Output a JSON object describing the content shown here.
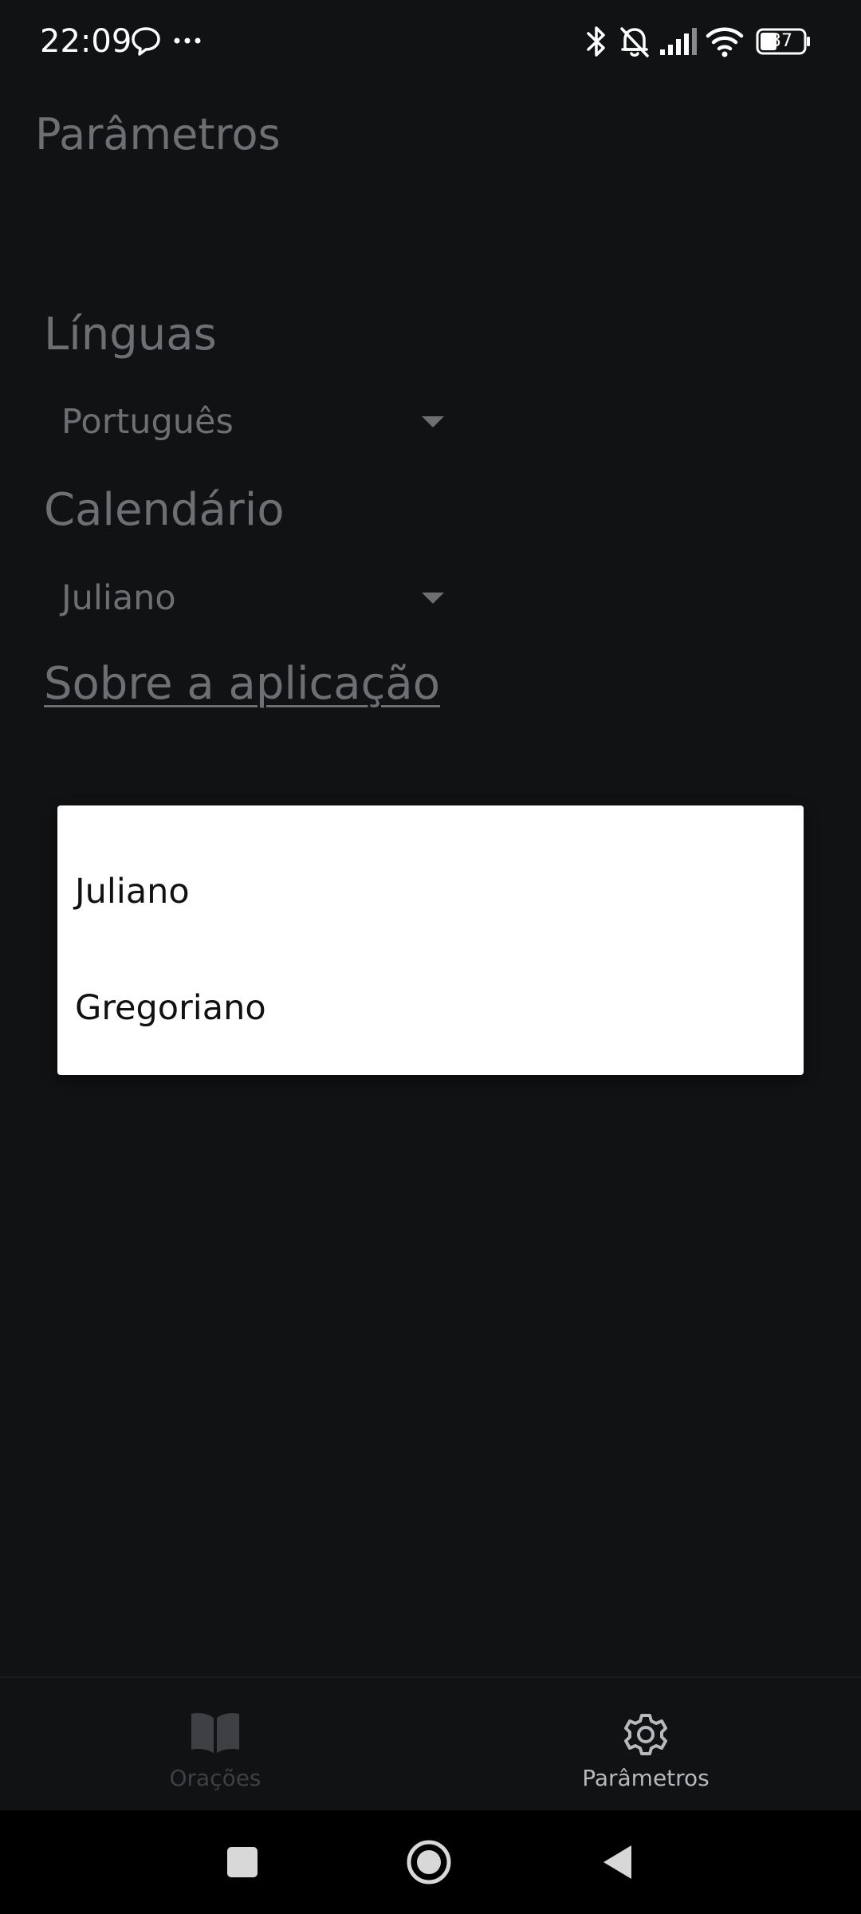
{
  "status_bar": {
    "time": "22:09",
    "battery_level": "37",
    "icons": [
      "chat-bubble-icon",
      "more-dots-icon",
      "bluetooth-icon",
      "bell-off-icon",
      "cellular-signal-icon",
      "wifi-icon",
      "battery-icon"
    ]
  },
  "app_bar": {
    "title": "Parâmetros"
  },
  "settings": {
    "languages_heading": "Línguas",
    "language_selected": "Português",
    "calendar_heading": "Calendário",
    "calendar_selected": "Juliano",
    "about_link": "Sobre a aplicação"
  },
  "dropdown": {
    "options": [
      "Juliano",
      "Gregoriano"
    ]
  },
  "bottom_nav": {
    "items": [
      {
        "label": "Orações",
        "icon": "book-icon",
        "active": false
      },
      {
        "label": "Parâmetros",
        "icon": "gear-icon",
        "active": true
      }
    ]
  },
  "system_nav": {
    "buttons": [
      "recents-square-icon",
      "home-circle-icon",
      "back-triangle-icon"
    ]
  },
  "colors": {
    "background": "#111214",
    "dimmed_text": "#6e6f72",
    "popup_background": "#ffffff",
    "nav_inactive": "#3f4043",
    "nav_active": "#b8b9bc"
  }
}
